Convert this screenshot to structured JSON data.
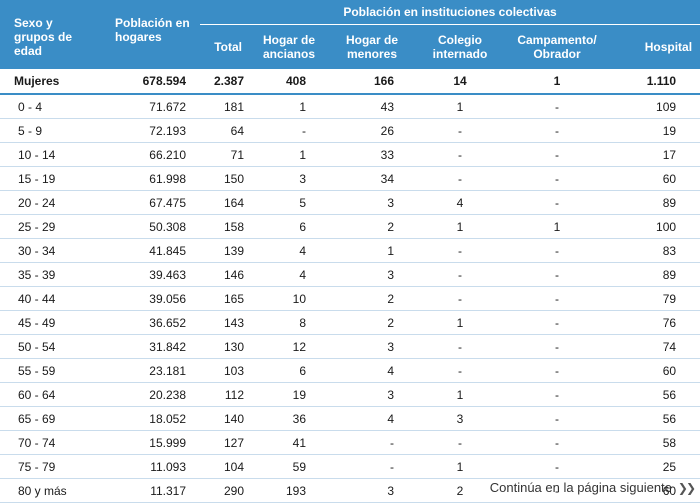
{
  "header": {
    "col_sexo": "Sexo y grupos de edad",
    "col_poblacion": "Población en hogares",
    "group_title": "Población en instituciones colectivas",
    "sub": [
      "Total",
      "Hogar de ancianos",
      "Hogar de menores",
      "Colegio internado",
      "Campamento/ Obrador",
      "Hospital"
    ]
  },
  "rows": [
    [
      "Mujeres",
      "678.594",
      "2.387",
      "408",
      "166",
      "14",
      "1",
      "1.110"
    ],
    [
      "0 - 4",
      "71.672",
      "181",
      "1",
      "43",
      "1",
      "-",
      "109"
    ],
    [
      "5 - 9",
      "72.193",
      "64",
      "-",
      "26",
      "-",
      "-",
      "19"
    ],
    [
      "10 - 14",
      "66.210",
      "71",
      "1",
      "33",
      "-",
      "-",
      "17"
    ],
    [
      "15 - 19",
      "61.998",
      "150",
      "3",
      "34",
      "-",
      "-",
      "60"
    ],
    [
      "20 - 24",
      "67.475",
      "164",
      "5",
      "3",
      "4",
      "-",
      "89"
    ],
    [
      "25 - 29",
      "50.308",
      "158",
      "6",
      "2",
      "1",
      "1",
      "100"
    ],
    [
      "30 - 34",
      "41.845",
      "139",
      "4",
      "1",
      "-",
      "-",
      "83"
    ],
    [
      "35 - 39",
      "39.463",
      "146",
      "4",
      "3",
      "-",
      "-",
      "89"
    ],
    [
      "40 - 44",
      "39.056",
      "165",
      "10",
      "2",
      "-",
      "-",
      "79"
    ],
    [
      "45 - 49",
      "36.652",
      "143",
      "8",
      "2",
      "1",
      "-",
      "76"
    ],
    [
      "50 - 54",
      "31.842",
      "130",
      "12",
      "3",
      "-",
      "-",
      "74"
    ],
    [
      "55 - 59",
      "23.181",
      "103",
      "6",
      "4",
      "-",
      "-",
      "60"
    ],
    [
      "60 - 64",
      "20.238",
      "112",
      "19",
      "3",
      "1",
      "-",
      "56"
    ],
    [
      "65 - 69",
      "18.052",
      "140",
      "36",
      "4",
      "3",
      "-",
      "56"
    ],
    [
      "70 - 74",
      "15.999",
      "127",
      "41",
      "-",
      "-",
      "-",
      "58"
    ],
    [
      "75 - 79",
      "11.093",
      "104",
      "59",
      "-",
      "1",
      "-",
      "25"
    ],
    [
      "80 y más",
      "11.317",
      "290",
      "193",
      "3",
      "2",
      "-",
      "60"
    ]
  ],
  "footer": {
    "text": "Continúa en la página siguiente",
    "icon": "double-chevron-right-icon"
  },
  "colors": {
    "header_bg": "#3a8dc6",
    "row_rule": "#c9dcec"
  }
}
